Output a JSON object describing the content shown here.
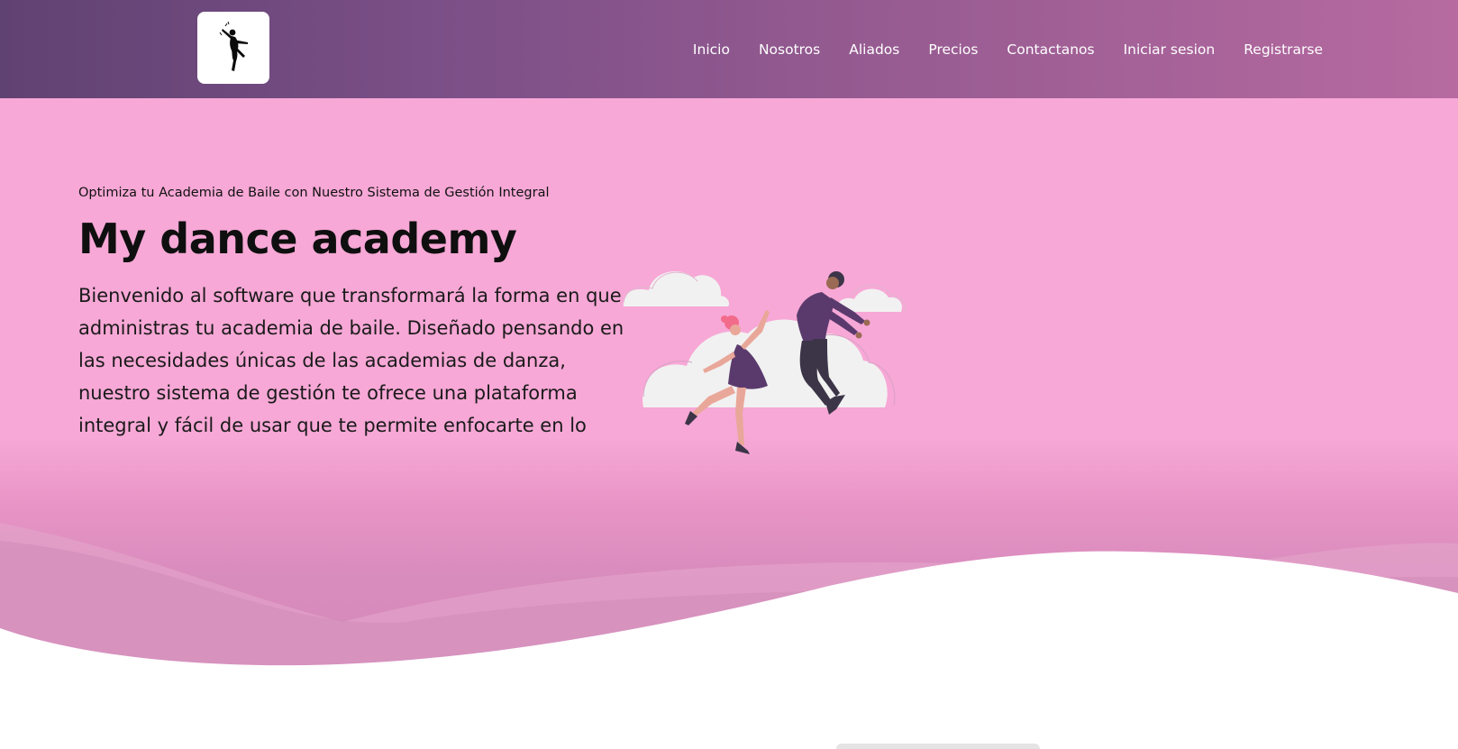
{
  "header": {
    "logo_icon": "dancer-silhouette-icon",
    "nav": [
      {
        "label": "Inicio"
      },
      {
        "label": "Nosotros"
      },
      {
        "label": "Aliados"
      },
      {
        "label": "Precios"
      },
      {
        "label": "Contactanos"
      },
      {
        "label": "Iniciar sesion"
      },
      {
        "label": "Registrarse"
      }
    ]
  },
  "hero": {
    "subtitle": "Optimiza tu Academia de Baile con Nuestro Sistema de Gestión Integral",
    "title": "My dance academy",
    "description": "Bienvenido al software que transformará la forma en que administras tu academia de baile. Diseñado pensando en las necesidades únicas de las academias de danza, nuestro sistema de gestión te ofrece una plataforma integral y fácil de usar que te permite enfocarte en lo",
    "illustration_icon": "dancing-couple-illustration"
  },
  "colors": {
    "header_start": "#604272",
    "header_end": "#b66aa0",
    "hero_bg": "#f7a8d6",
    "wave": "#d48ab9",
    "text": "#111111"
  }
}
